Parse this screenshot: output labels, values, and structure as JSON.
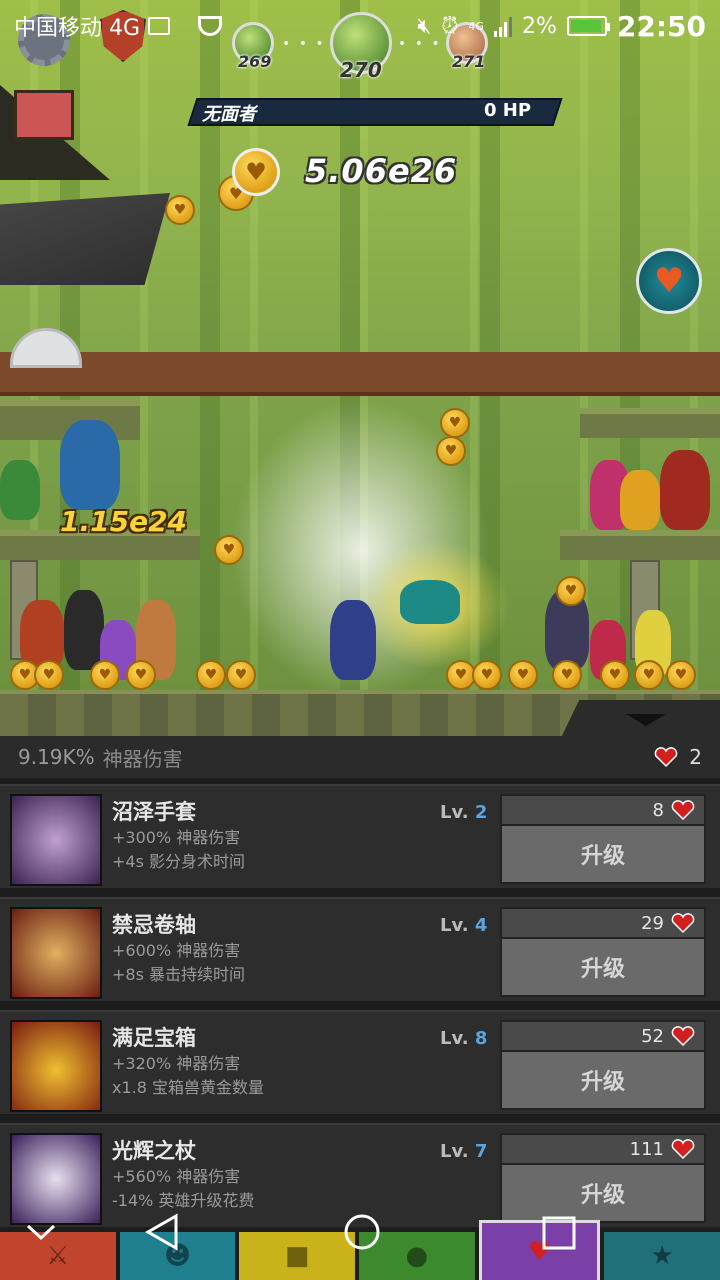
{
  "status_bar": {
    "carrier": "中国移动 4G",
    "network": "4G",
    "battery_percent": "2%",
    "battery_level": 0.02,
    "time": "22:50"
  },
  "stages": {
    "prev": "269",
    "current": "270",
    "next": "271"
  },
  "boss": {
    "name": "无面者",
    "hp": "0 HP"
  },
  "gold": {
    "amount": "5.06e26"
  },
  "damage_popup": "1.15e24",
  "panel": {
    "summary_value": "9.19K%",
    "summary_label": "神器伤害",
    "gem_count": "2",
    "artifacts": [
      {
        "name": "沼泽手套",
        "effect1": "+300% 神器伤害",
        "effect2": "+4s 影分身术时间",
        "lv_label": "Lv.",
        "level": "2",
        "cost": "8",
        "button": "升级",
        "thumb_color": "#3b2250"
      },
      {
        "name": "禁忌卷轴",
        "effect1": "+600% 神器伤害",
        "effect2": "+8s 暴击持续时间",
        "lv_label": "Lv.",
        "level": "4",
        "cost": "29",
        "button": "升级",
        "thumb_color": "#6a1e12"
      },
      {
        "name": "满足宝箱",
        "effect1": "+320% 神器伤害",
        "effect2": "x1.8 宝箱兽黄金数量",
        "lv_label": "Lv.",
        "level": "8",
        "cost": "52",
        "button": "升级",
        "thumb_color": "#7a1a10"
      },
      {
        "name": "光辉之杖",
        "effect1": "+560% 神器伤害",
        "effect2": "-14% 英雄升级花费",
        "lv_label": "Lv.",
        "level": "7",
        "cost": "111",
        "button": "升级",
        "thumb_color": "#3a1f5a"
      }
    ]
  },
  "tabs": [
    {
      "icon": "sword-icon",
      "color": "#c0452c",
      "active": false
    },
    {
      "icon": "hero-icon",
      "color": "#1f7f8e",
      "active": false
    },
    {
      "icon": "shirt-icon",
      "color": "#c9b21a",
      "active": false
    },
    {
      "icon": "pet-icon",
      "color": "#3d8a2e",
      "active": false
    },
    {
      "icon": "artifact-icon",
      "color": "#7b3fa8",
      "active": true
    },
    {
      "icon": "star-icon",
      "color": "#1f7078",
      "active": false
    }
  ],
  "colors": {
    "panel_bg": "#2d2d2d",
    "level_accent": "#5aa5e0",
    "upgrade_button": "#6a6a6a"
  }
}
